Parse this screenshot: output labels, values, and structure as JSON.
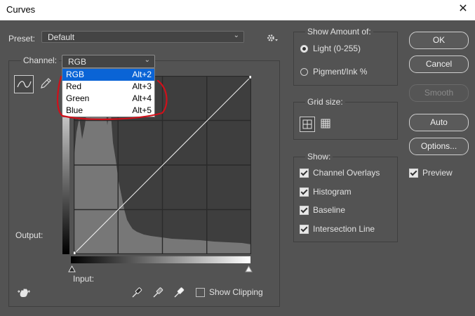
{
  "window": {
    "title": "Curves",
    "close": "✕"
  },
  "preset": {
    "label": "Preset:",
    "value": "Default"
  },
  "channel": {
    "label": "Channel:",
    "value": "RGB"
  },
  "channel_menu": [
    {
      "name": "RGB",
      "shortcut": "Alt+2",
      "selected": true
    },
    {
      "name": "Red",
      "shortcut": "Alt+3",
      "selected": false
    },
    {
      "name": "Green",
      "shortcut": "Alt+4",
      "selected": false
    },
    {
      "name": "Blue",
      "shortcut": "Alt+5",
      "selected": false
    }
  ],
  "graph": {
    "output_label": "Output:",
    "input_label": "Input:",
    "show_clipping": "Show Clipping"
  },
  "show_amount": {
    "title": "Show Amount of:",
    "light": "Light  (0-255)",
    "pigment": "Pigment/Ink %",
    "selected": "light"
  },
  "grid_size": {
    "title": "Grid size:"
  },
  "show": {
    "title": "Show:",
    "channel_overlays": "Channel Overlays",
    "histogram": "Histogram",
    "baseline": "Baseline",
    "intersection_line": "Intersection Line"
  },
  "buttons": {
    "ok": "OK",
    "cancel": "Cancel",
    "smooth": "Smooth",
    "auto": "Auto",
    "options": "Options..."
  },
  "preview": "Preview",
  "colors": {
    "highlight": "#0a64d6",
    "annotation": "#d0101a",
    "panel": "#535353"
  }
}
